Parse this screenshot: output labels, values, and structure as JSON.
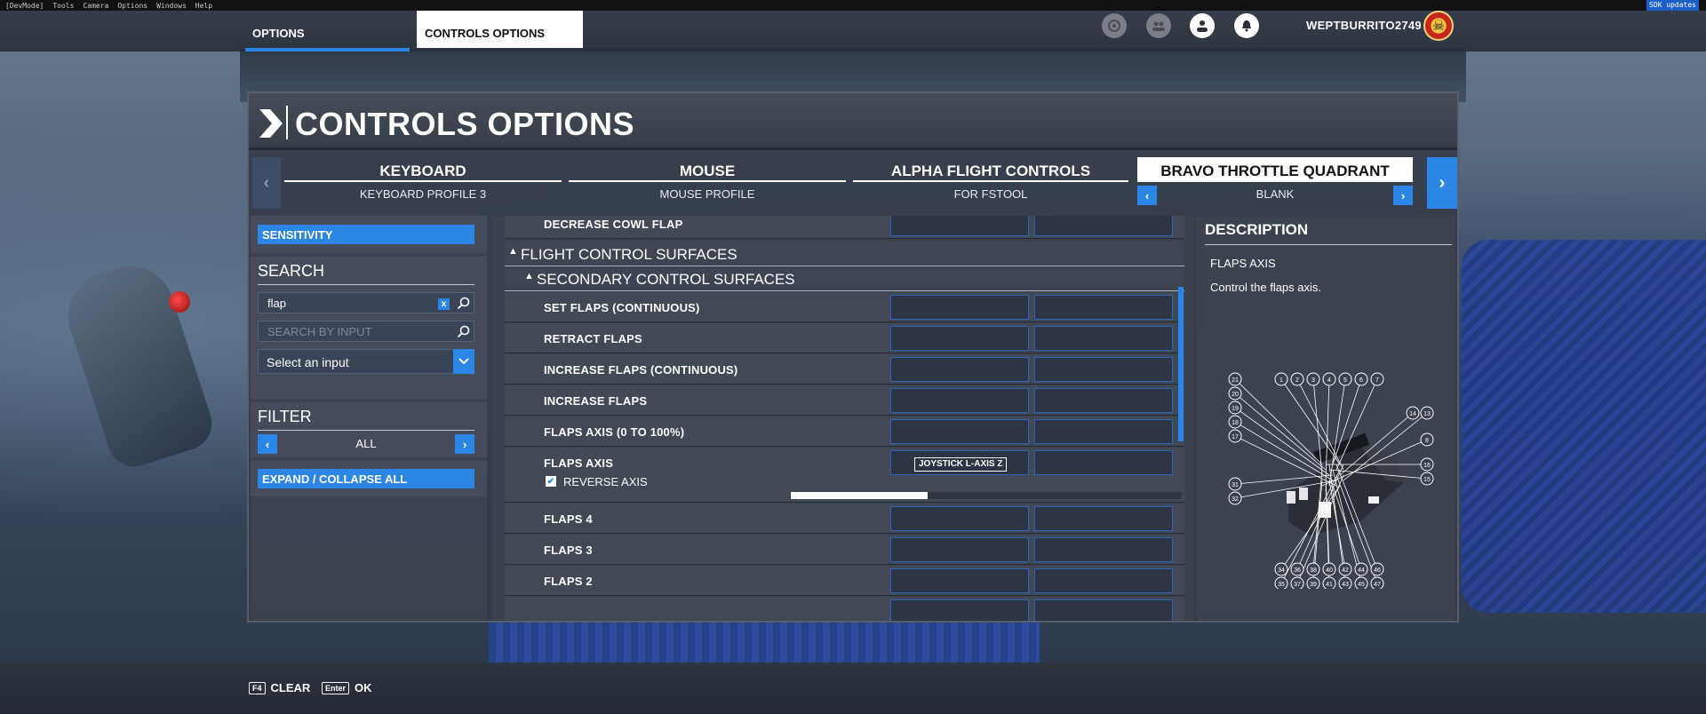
{
  "devbar": {
    "items": [
      "[DevMode]",
      "Tools",
      "Camera",
      "Options",
      "Windows",
      "Help"
    ],
    "sdk_badge": "SDK updates"
  },
  "topnav": {
    "tab_options": "OPTIONS",
    "tab_controls_options": "CONTROLS OPTIONS",
    "username": "WEPTBURRITO2749"
  },
  "panel": {
    "title": "CONTROLS OPTIONS"
  },
  "devices": [
    {
      "name": "KEYBOARD",
      "profile": "KEYBOARD PROFILE 3"
    },
    {
      "name": "MOUSE",
      "profile": "MOUSE PROFILE"
    },
    {
      "name": "ALPHA FLIGHT CONTROLS",
      "profile": "FOR FSTOOL"
    },
    {
      "name": "BRAVO THROTTLE QUADRANT",
      "profile": "BLANK"
    }
  ],
  "left": {
    "sensitivity_button": "SENSITIVITY",
    "search_label": "SEARCH",
    "search_value": "flap",
    "clear_x": "x",
    "search_by_input_placeholder": "SEARCH BY INPUT",
    "select_input": "Select an input",
    "filter_label": "FILTER",
    "filter_value": "ALL",
    "expand_collapse": "EXPAND / COLLAPSE ALL"
  },
  "list": {
    "top_row": "DECREASE COWL FLAP",
    "category": "FLIGHT CONTROL SURFACES",
    "subcategory": "SECONDARY CONTROL SURFACES",
    "rows": [
      "SET FLAPS (CONTINUOUS)",
      "RETRACT FLAPS",
      "INCREASE FLAPS (CONTINUOUS)",
      "INCREASE FLAPS",
      "FLAPS AXIS (0 TO 100%)"
    ],
    "flaps_axis": {
      "label": "FLAPS AXIS",
      "binding": "JOYSTICK L-AXIS Z",
      "reverse_label": "REVERSE AXIS",
      "reverse_checked": true,
      "sensitivity_fraction": 0.35
    },
    "rows_after": [
      "FLAPS 4",
      "FLAPS 3",
      "FLAPS 2"
    ]
  },
  "description": {
    "title": "DESCRIPTION",
    "name": "FLAPS AXIS",
    "text": "Control the flaps axis.",
    "diagram_numbers": [
      "21",
      "20",
      "19",
      "18",
      "17",
      "1",
      "2",
      "3",
      "4",
      "5",
      "6",
      "7",
      "14",
      "13",
      "8",
      "16",
      "15",
      "31",
      "32",
      "34",
      "36",
      "38",
      "40",
      "42",
      "44",
      "46",
      "35",
      "37",
      "39",
      "41",
      "43",
      "45",
      "47"
    ]
  },
  "bottom": {
    "clear_key": "F4",
    "clear_label": "CLEAR",
    "ok_key": "Enter",
    "ok_label": "OK"
  },
  "colors": {
    "accent": "#2b86e6"
  }
}
